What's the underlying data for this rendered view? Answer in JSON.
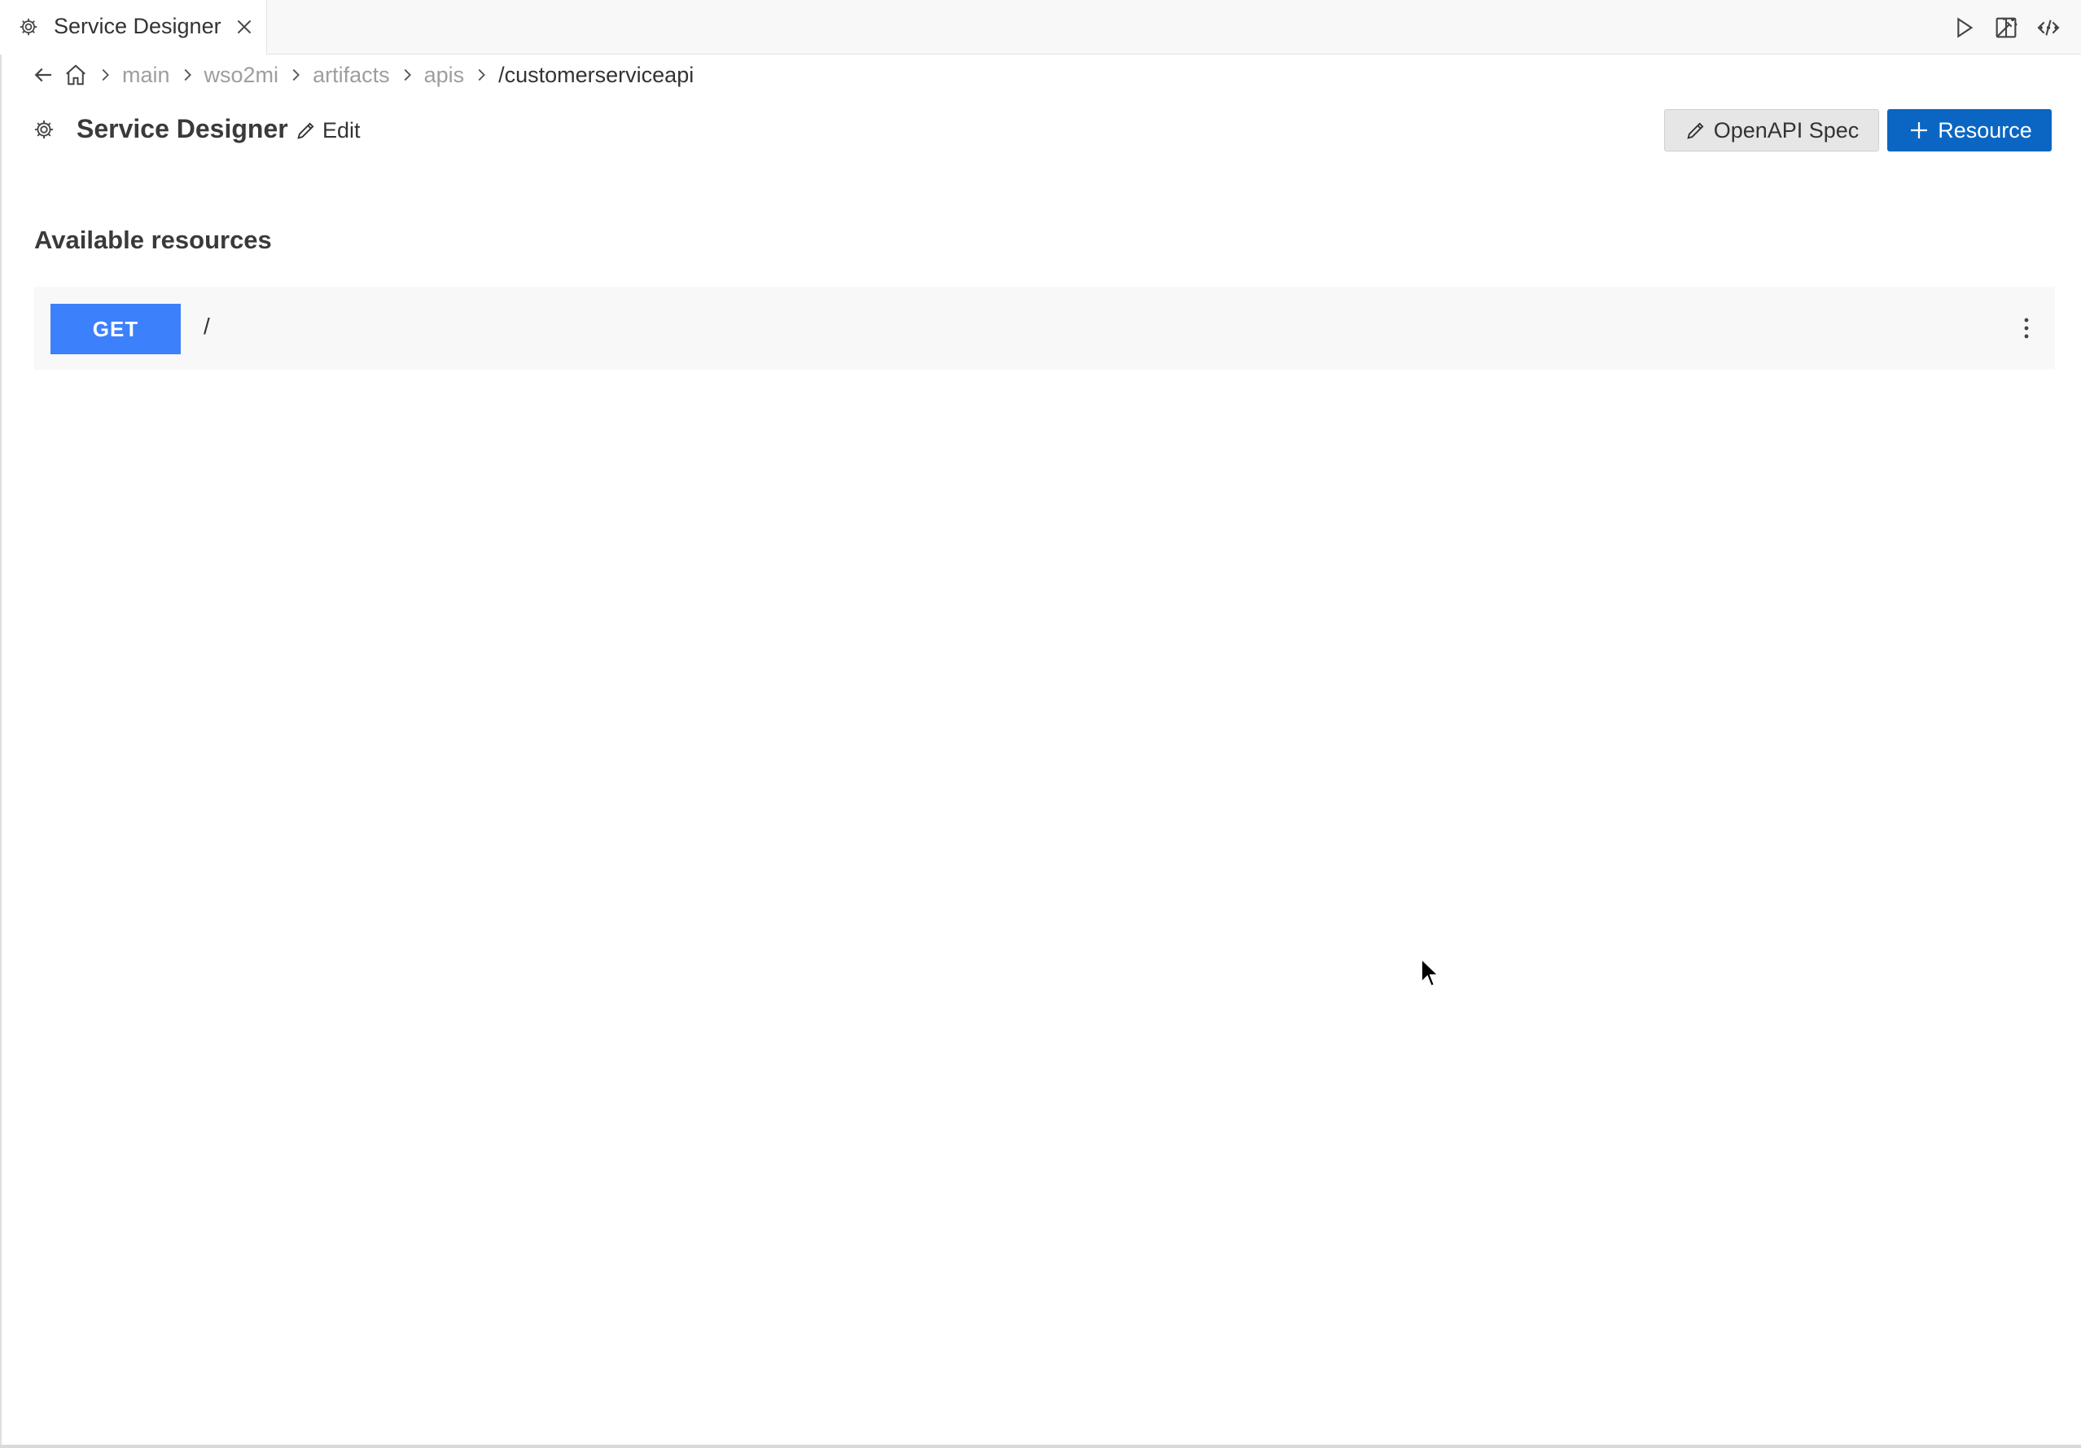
{
  "tab": {
    "title": "Service Designer",
    "icon": "gear-icon",
    "close_icon": "close-icon"
  },
  "editor_actions": [
    {
      "name": "run-icon"
    },
    {
      "name": "magic-wand-icon"
    },
    {
      "name": "code-icon"
    },
    {
      "name": "split-editor-icon"
    },
    {
      "name": "more-actions-icon"
    }
  ],
  "breadcrumb": {
    "items": [
      "main",
      "wso2mi",
      "artifacts",
      "apis",
      "/customerserviceapi"
    ]
  },
  "header": {
    "title": "Service Designer",
    "edit_label": "Edit",
    "openapi_label": "OpenAPI Spec",
    "add_resource_label": "Resource"
  },
  "resources": {
    "section_title": "Available resources",
    "items": [
      {
        "method": "GET",
        "path": "/"
      }
    ]
  },
  "colors": {
    "accent": "#0a66c2",
    "get_method": "#3d80fc",
    "muted_text": "#9e9e9e"
  }
}
